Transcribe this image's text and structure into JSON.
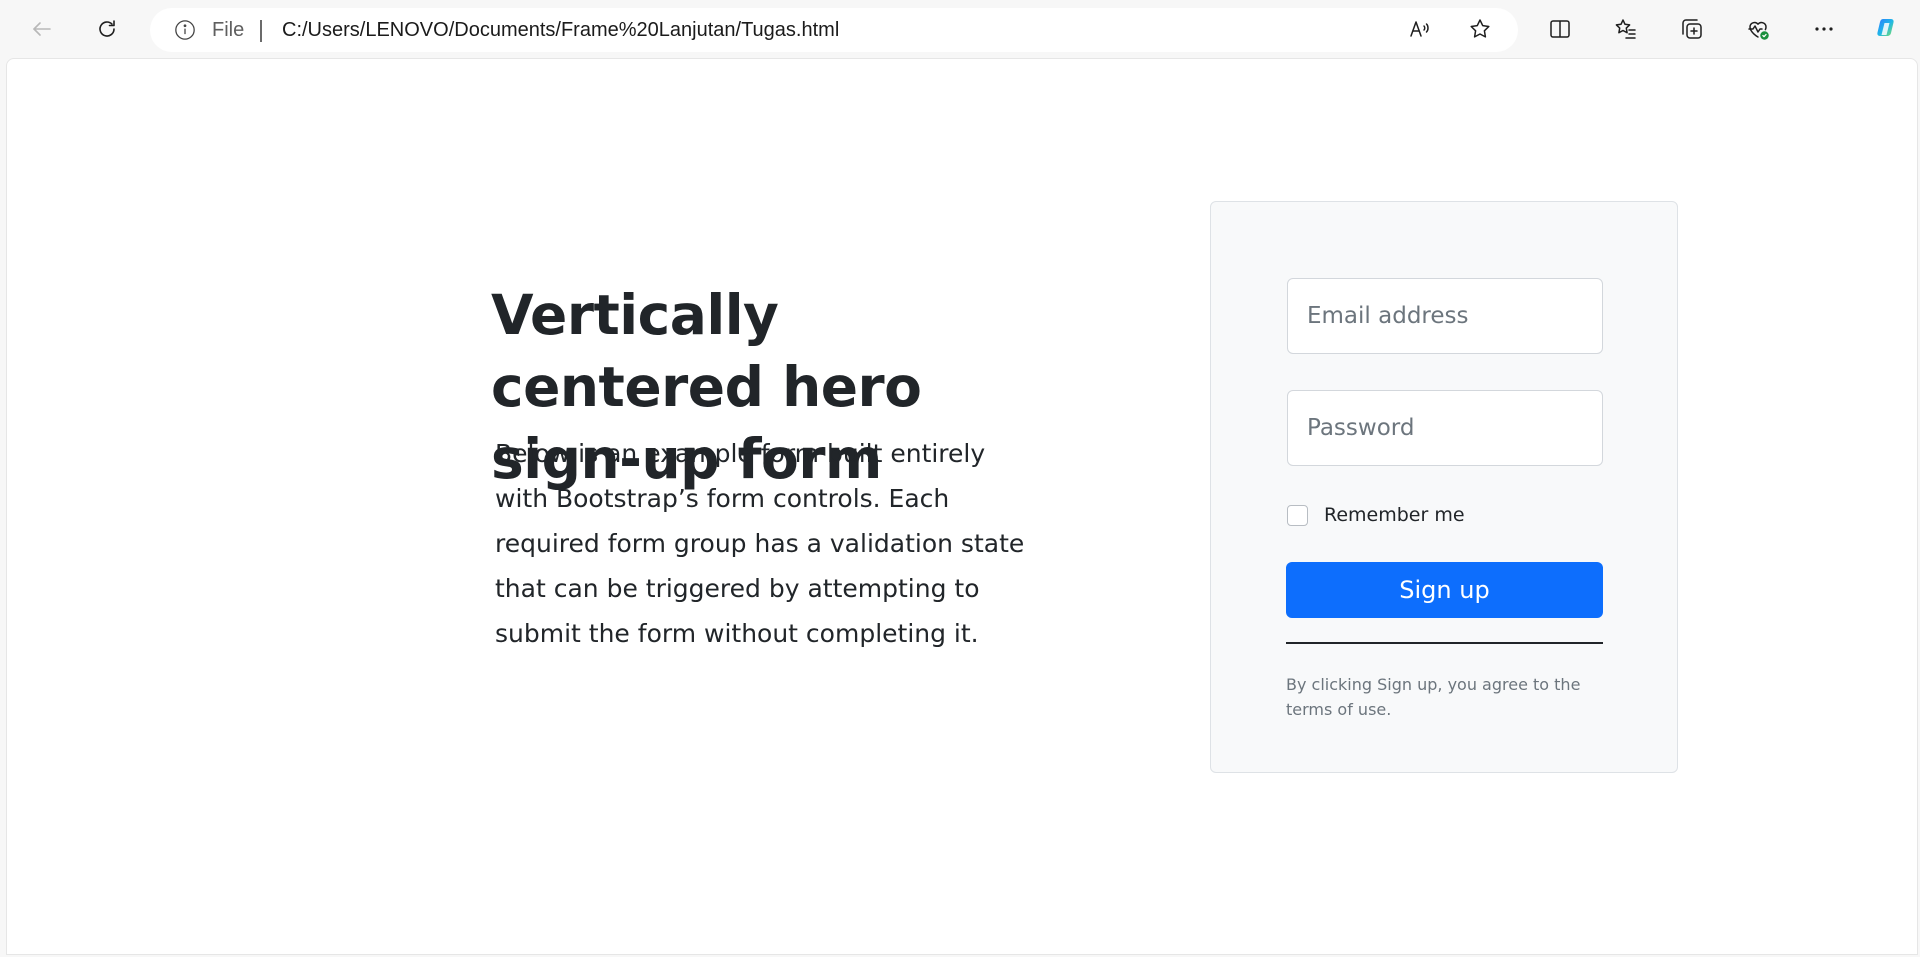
{
  "browser": {
    "address": {
      "scheme_label": "File",
      "url": "C:/Users/LENOVO/Documents/Frame%20Lanjutan/Tugas.html"
    },
    "icons": {
      "back": "back-arrow-icon",
      "reload": "reload-icon",
      "info": "info-icon",
      "read_aloud": "read-aloud-icon",
      "favorite": "star-icon",
      "split": "split-screen-icon",
      "favorites": "favorites-icon",
      "collections": "collections-icon",
      "health": "browser-essentials-icon",
      "more": "more-icon",
      "copilot": "copilot-icon"
    }
  },
  "hero": {
    "title": "Vertically centered hero sign-up form",
    "description": "Below is an example form built entirely with Bootstrap’s form controls. Each required form group has a validation state that can be triggered by attempting to submit the form without completing it."
  },
  "form": {
    "email_placeholder": "Email address",
    "password_placeholder": "Password",
    "remember_label": "Remember me",
    "remember_checked": false,
    "submit_label": "Sign up",
    "terms": "By clicking Sign up, you agree to the terms of use."
  },
  "colors": {
    "primary": "#0d6efd",
    "text": "#212529",
    "muted": "#6c757d",
    "card_bg": "#f8f9fa"
  }
}
